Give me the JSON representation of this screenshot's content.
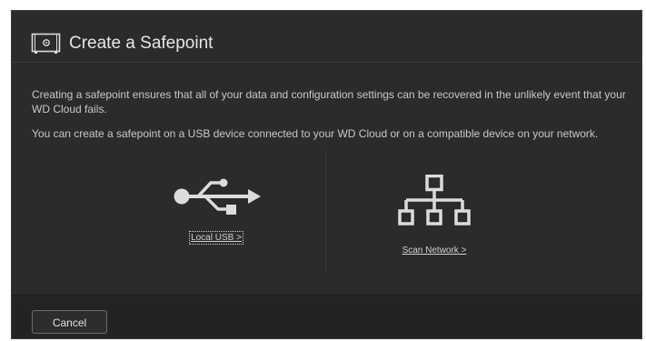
{
  "dialog": {
    "title": "Create a Safepoint",
    "title_icon": "safe-icon",
    "description_1": "Creating a safepoint ensures that all of your data and configuration settings can be recovered in the unlikely event that your WD Cloud fails.",
    "description_2": "You can create a safepoint on a USB device connected to your WD Cloud or on a compatible device on your network."
  },
  "options": {
    "usb": {
      "icon": "usb-icon",
      "label": "Local USB >"
    },
    "network": {
      "icon": "network-icon",
      "label": "Scan Network >"
    }
  },
  "footer": {
    "cancel_label": "Cancel"
  },
  "colors": {
    "dialog_bg": "#2b2b2b",
    "footer_bg": "#232323",
    "text": "#c8c8c8",
    "icon": "#dcdcdc"
  }
}
